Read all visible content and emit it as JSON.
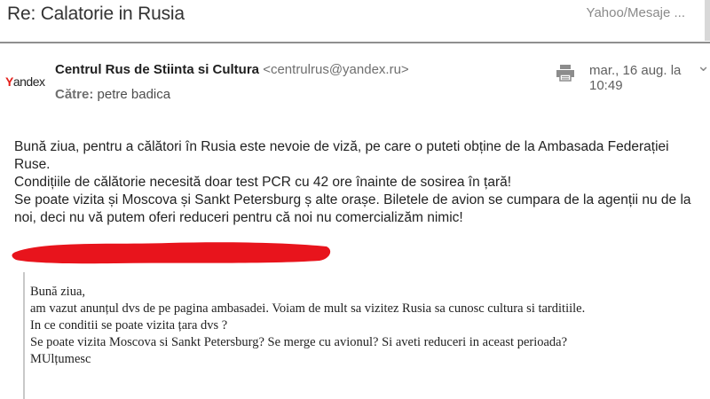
{
  "header": {
    "subject": "Re: Calatorie in Rusia",
    "folder": "Yahoo/Mesaje ..."
  },
  "sender": {
    "logo_letter": "Y",
    "logo_rest": "andex",
    "name": "Centrul Rus de Stiinta si Cultura",
    "email": "<centrulrus@yandex.ru>",
    "to_label": "Către:",
    "to_name": "petre badica",
    "date": "mar., 16 aug. la 10:49"
  },
  "message": {
    "lines": [
      "Bună ziua, pentru a călători în Rusia este nevoie de viză, pe care o puteti obține de la Ambasada Federației Ruse.",
      "Condițiile de călătorie necesită doar test PCR cu 42 ore înainte de sosirea în țară!",
      "Se poate vizita și Moscova și Sankt Petersburg ș alte orașe. Biletele de avion se cumpara de la agenții nu de la noi, deci nu vă putem oferi reduceri pentru că noi nu comercializăm nimic!"
    ]
  },
  "quoted": {
    "lines": [
      "Bună ziua,",
      "am vazut anunțul dvs de pe pagina ambasadei. Voiam de mult sa vizitez Rusia sa cunosc cultura si tarditiile.",
      "In ce conditii se poate vizita țara dvs ?",
      "Se poate vizita Moscova si Sankt Petersburg? Se merge cu avionul? Si aveti reduceri in aceast perioada?",
      "MUlțumesc"
    ]
  },
  "icons": {
    "print": "printer-icon",
    "expand": "chevron-down-icon"
  },
  "colors": {
    "redaction": "#e8141c",
    "logo_accent": "#e4201b"
  }
}
